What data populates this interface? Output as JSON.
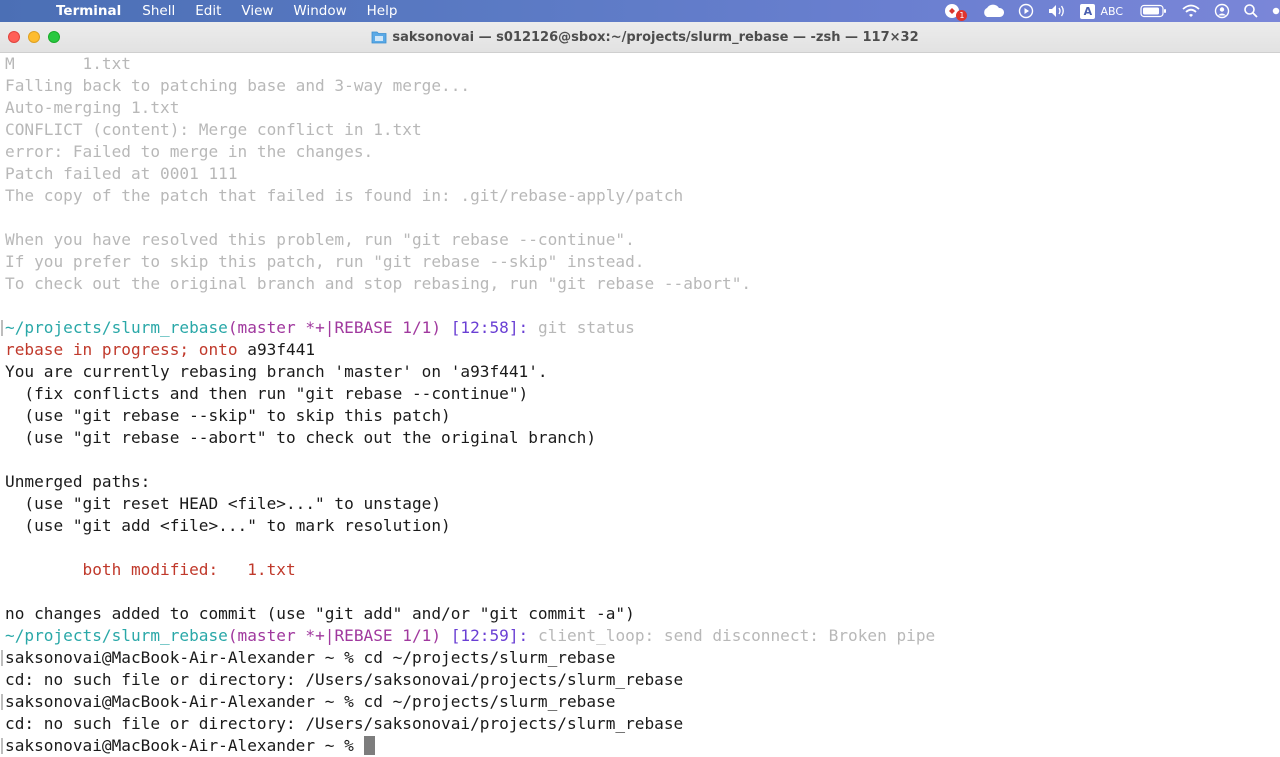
{
  "menubar": {
    "apple_glyph": "",
    "app_name": "Terminal",
    "items": [
      "Shell",
      "Edit",
      "View",
      "Window",
      "Help"
    ],
    "status": {
      "notification_badge": "1",
      "input_source_letter": "A",
      "input_source_label": "ABC"
    }
  },
  "window": {
    "title": "saksonovai — s012126@sbox:~/projects/slurm_rebase — -zsh — 117×32"
  },
  "colors": {
    "path": "#2aa8a8",
    "branch": "#a0389e",
    "time": "#6a3fd4",
    "error_red": "#c0392b",
    "dim_text": "#b8b8b8"
  },
  "terminal": {
    "lines": [
      {
        "text": "M       1.txt"
      },
      {
        "text": "Falling back to patching base and 3-way merge..."
      },
      {
        "text": "Auto-merging 1.txt"
      },
      {
        "text": "CONFLICT (content): Merge conflict in 1.txt"
      },
      {
        "text": "error: Failed to merge in the changes."
      },
      {
        "text": "Patch failed at 0001 111"
      },
      {
        "text": "The copy of the patch that failed is found in: .git/rebase-apply/patch"
      },
      {
        "text": ""
      },
      {
        "text": "When you have resolved this problem, run \"git rebase --continue\"."
      },
      {
        "text": "If you prefer to skip this patch, run \"git rebase --skip\" instead."
      },
      {
        "text": "To check out the original branch and stop rebasing, run \"git rebase --abort\"."
      },
      {
        "text": ""
      },
      {
        "prompt": {
          "path": "~/projects/slurm_rebase",
          "branch": "(master *+|REBASE 1/1)",
          "time": "[12:58]:",
          "command": "git status"
        }
      },
      {
        "text_red": "rebase in progress; onto",
        "text": "a93f441"
      },
      {
        "text": "You are currently rebasing branch 'master' on 'a93f441'."
      },
      {
        "text": "  (fix conflicts and then run \"git rebase --continue\")"
      },
      {
        "text": "  (use \"git rebase --skip\" to skip this patch)"
      },
      {
        "text": "  (use \"git rebase --abort\" to check out the original branch)"
      },
      {
        "text": ""
      },
      {
        "text": "Unmerged paths:"
      },
      {
        "text": "  (use \"git reset HEAD <file>...\" to unstage)"
      },
      {
        "text": "  (use \"git add <file>...\" to mark resolution)"
      },
      {
        "text": ""
      },
      {
        "text_red": "        both modified:   1.txt"
      },
      {
        "text": ""
      },
      {
        "text": "no changes added to commit (use \"git add\" and/or \"git commit -a\")"
      },
      {
        "prompt": {
          "path": "~/projects/slurm_rebase",
          "branch": "(master *+|REBASE 1/1)",
          "time": "[12:59]:",
          "command": "client_loop: send disconnect: Broken pipe"
        }
      },
      {
        "text": "saksonovai@MacBook-Air-Alexander ~ % cd ~/projects/slurm_rebase"
      },
      {
        "text": "cd: no such file or directory: /Users/saksonovai/projects/slurm_rebase"
      },
      {
        "text": "saksonovai@MacBook-Air-Alexander ~ % cd ~/projects/slurm_rebase"
      },
      {
        "text": "cd: no such file or directory: /Users/saksonovai/projects/slurm_rebase"
      },
      {
        "text": "saksonovai@MacBook-Air-Alexander ~ % "
      }
    ]
  }
}
